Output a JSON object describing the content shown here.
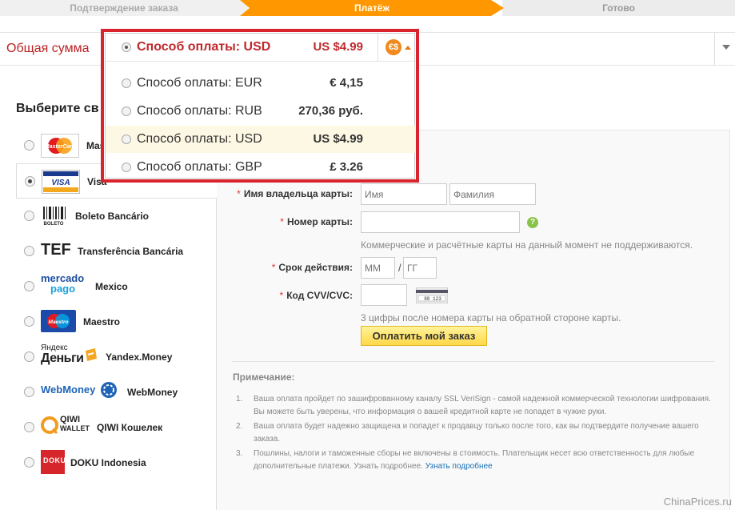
{
  "steps": {
    "confirm": "Подтверждение заказа",
    "payment": "Платёж",
    "done": "Готово"
  },
  "total": {
    "label": "Общая сумма"
  },
  "choose_title": "Выберите св",
  "currency_dropdown": {
    "options": [
      {
        "label": "Способ оплаты: USD",
        "amount": "US $4.99",
        "checked": true
      },
      {
        "label": "Способ оплаты: EUR",
        "amount": "€ 4,15",
        "checked": false
      },
      {
        "label": "Способ оплаты: RUB",
        "amount": "270,36 руб.",
        "checked": false
      },
      {
        "label": "Способ оплаты: USD",
        "amount": "US $4.99",
        "checked": false
      },
      {
        "label": "Способ оплаты: GBP",
        "amount": "£ 3.26",
        "checked": false
      }
    ],
    "coin_glyph": "€$",
    "accent_color": "#d9232d"
  },
  "methods": [
    {
      "name": "Mas",
      "logo": "mastercard-icon"
    },
    {
      "name": "Visa",
      "logo": "visa-icon",
      "selected": true
    },
    {
      "name": "Boleto Bancário",
      "logo": "boleto-icon",
      "logo_text": "BOLETO"
    },
    {
      "name": "Transferência Bancária",
      "logo": "tef-icon",
      "logo_text": "TEF"
    },
    {
      "name": "Mexico",
      "logo": "mercadopago-icon",
      "logo_text": "mercado",
      "logo_text2": "pago"
    },
    {
      "name": "Maestro",
      "logo": "maestro-icon",
      "logo_text": "Maestro"
    },
    {
      "name": "Yandex.Money",
      "logo": "yandex-money-icon",
      "logo_text": "Яндекс",
      "logo_text2": "Деньги"
    },
    {
      "name": "WebMoney",
      "logo": "webmoney-icon",
      "logo_text": "WebMoney"
    },
    {
      "name": "QIWI Кошелек",
      "logo": "qiwi-icon",
      "logo_text": "QIWI",
      "logo_text2": "WALLET"
    },
    {
      "name": "DOKU Indonesia",
      "logo": "doku-icon",
      "logo_text": "DOKU"
    }
  ],
  "form": {
    "holder_label": "Имя владельца карты:",
    "first_name_placeholder": "Имя",
    "last_name_placeholder": "Фамилия",
    "card_label": "Номер карты:",
    "card_hint": "Коммерческие и расчётные карты на данный момент не поддерживаются.",
    "expiry_label": "Срок действия:",
    "month_placeholder": "ММ",
    "year_placeholder": "ГГ",
    "slash": "/",
    "cvv_label": "Код CVV/CVC:",
    "cvv_card_digits": "88 123",
    "cvv_hint": "3 цифры после номера карты на обратной стороне карты.",
    "help_glyph": "?",
    "required_mark": "*",
    "pay_button": "Оплатить мой заказ"
  },
  "note": {
    "title": "Примечание:",
    "items": [
      {
        "num": "1.",
        "text": "Ваша оплата пройдет по зашифрованному каналу SSL VeriSign - самой надежной коммерческой технологии шифрования. Вы можете быть уверены, что информация о вашей кредитной карте не попадет в чужие руки."
      },
      {
        "num": "2.",
        "text": "Ваша оплата будет надежно защищена и попадет к продавцу только после того, как вы подтвердите получение вашего заказа."
      },
      {
        "num": "3.",
        "text": "Пошлины, налоги и таможенные сборы не включены в стоимость. Плательщик несет всю ответственность для любые дополнительные платежи. Узнать подробнее.",
        "link": "Узнать подробнее"
      }
    ]
  },
  "watermark": "ChinaPrices.ru"
}
